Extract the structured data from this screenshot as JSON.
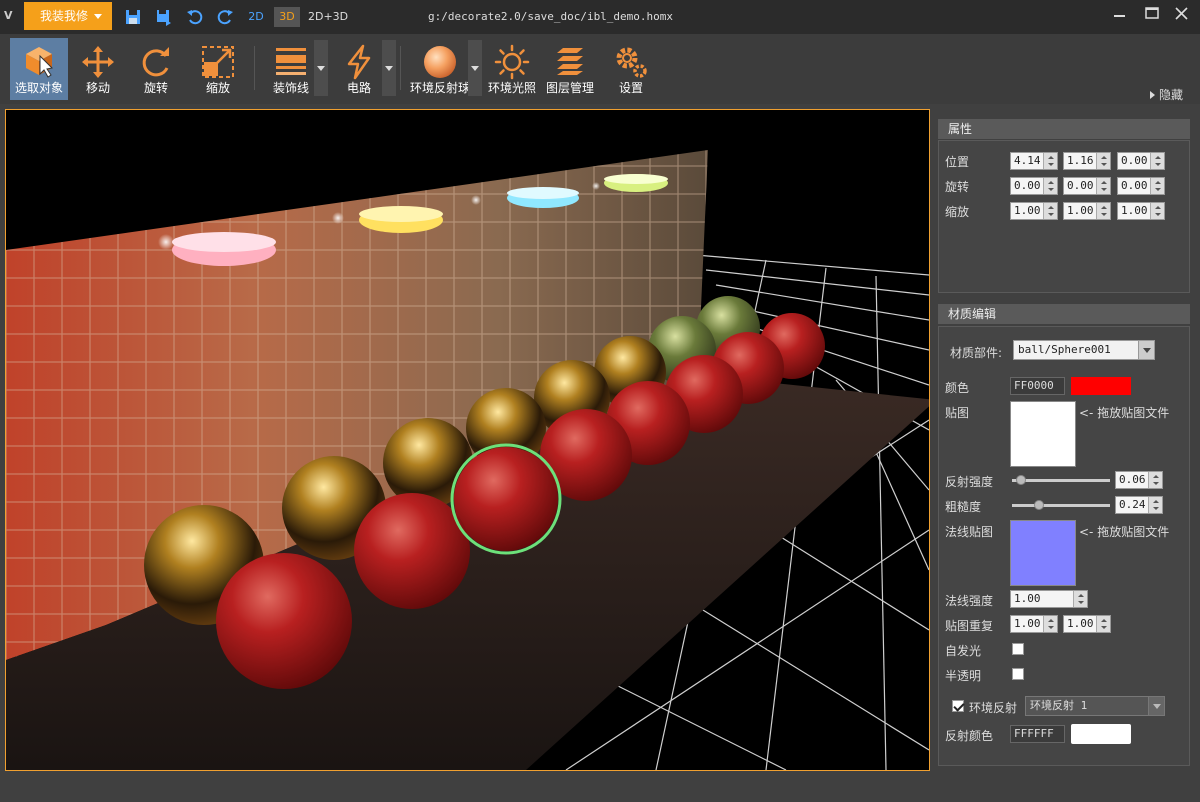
{
  "titlebar": {
    "app_logo": "V",
    "menu_label": "我装我修",
    "mode_2d": "2D",
    "mode_3d": "3D",
    "mode_2d3d": "2D+3D",
    "file_path": "g:/decorate2.0/save_doc/ibl_demo.homx"
  },
  "toolbar": {
    "tools": [
      {
        "label": "选取对象",
        "icon": "select-object-icon"
      },
      {
        "label": "移动",
        "icon": "move-icon"
      },
      {
        "label": "旋转",
        "icon": "rotate-icon"
      },
      {
        "label": "缩放",
        "icon": "scale-icon"
      },
      {
        "label": "装饰线",
        "icon": "decor-line-icon"
      },
      {
        "label": "电路",
        "icon": "circuit-icon"
      },
      {
        "label": "环境反射球",
        "icon": "env-reflection-sphere-icon"
      },
      {
        "label": "环境光照",
        "icon": "env-light-icon"
      },
      {
        "label": "图层管理",
        "icon": "layers-icon"
      },
      {
        "label": "设置",
        "icon": "settings-icon"
      }
    ],
    "hide_label": "隐藏"
  },
  "properties": {
    "title": "属性",
    "position_label": "位置",
    "position": [
      "4.14",
      "1.16",
      "0.00"
    ],
    "rotation_label": "旋转",
    "rotation": [
      "0.00",
      "0.00",
      "0.00"
    ],
    "scale_label": "缩放",
    "scale": [
      "1.00",
      "1.00",
      "1.00"
    ]
  },
  "material": {
    "title": "材质编辑",
    "part_label": "材质部件:",
    "part_value": "ball/Sphere001",
    "color_label": "颜色",
    "color_hex": "FF0000",
    "color_swatch": "#ff0000",
    "texture_label": "贴图",
    "texture_hint": "<- 拖放贴图文件",
    "reflect_label": "反射强度",
    "reflect_value": "0.06",
    "reflect_fraction": 0.06,
    "rough_label": "粗糙度",
    "rough_value": "0.24",
    "rough_fraction": 0.24,
    "normal_map_label": "法线贴图",
    "normal_map_hint": "<- 拖放贴图文件",
    "normal_map_color": "#8080ff",
    "normal_strength_label": "法线强度",
    "normal_strength": "1.00",
    "tex_repeat_label": "贴图重复",
    "tex_repeat": [
      "1.00",
      "1.00"
    ],
    "emissive_label": "自发光",
    "emissive": false,
    "transparent_label": "半透明",
    "transparent": false,
    "env_reflect_label": "环境反射",
    "env_reflect": true,
    "env_reflect_value": "环境反射 1",
    "reflect_color_label": "反射颜色",
    "reflect_color_hex": "FFFFFF",
    "reflect_color_swatch": "#ffffff"
  }
}
